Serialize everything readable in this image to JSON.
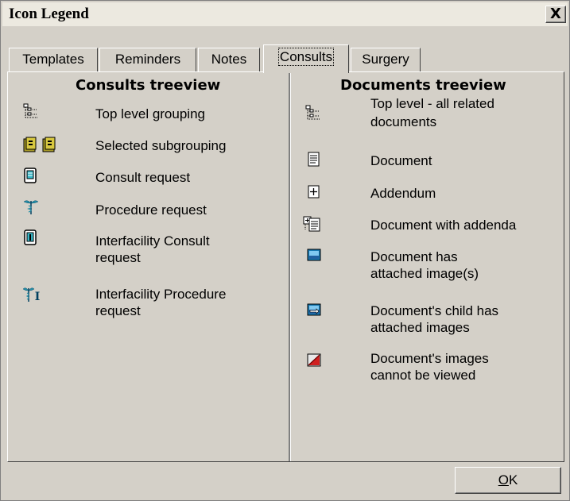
{
  "window": {
    "title": "Icon Legend",
    "close_glyph": "X"
  },
  "tabs": [
    {
      "label": "Templates",
      "active": false
    },
    {
      "label": "Reminders",
      "active": false
    },
    {
      "label": "Notes",
      "active": false
    },
    {
      "label": "Consults",
      "active": true
    },
    {
      "label": "Surgery",
      "active": false
    }
  ],
  "consults_treeview": {
    "title": "Consults treeview",
    "items": [
      {
        "icon": "tree-grouping-icon",
        "label": "Top level grouping"
      },
      {
        "icon": "subgrouping-books-icon",
        "label": "Selected subgrouping"
      },
      {
        "icon": "consult-request-icon",
        "label": "Consult request"
      },
      {
        "icon": "caduceus-icon",
        "label": "Procedure request"
      },
      {
        "icon": "interfacility-consult-icon",
        "label": "Interfacility Consult",
        "label2": "request"
      },
      {
        "icon": "interfacility-procedure-icon",
        "label": "Interfacility Procedure",
        "label2": "request"
      }
    ]
  },
  "documents_treeview": {
    "title": "Documents treeview",
    "items": [
      {
        "icon": "tree-grouping-icon",
        "label": "Top level - all related",
        "label2": "documents"
      },
      {
        "icon": "document-icon",
        "label": "Document"
      },
      {
        "icon": "addendum-icon",
        "label": "Addendum"
      },
      {
        "icon": "document-with-addenda-icon",
        "label": "Document with addenda"
      },
      {
        "icon": "image-attached-icon",
        "label": "Document has",
        "label2": "attached image(s)"
      },
      {
        "icon": "child-image-icon",
        "label": "Document's child has",
        "label2": "attached images"
      },
      {
        "icon": "image-blocked-icon",
        "label": "Document's images",
        "label2": "cannot be viewed"
      }
    ]
  },
  "footer": {
    "ok_label_first": "O",
    "ok_label_rest": "K"
  },
  "colors": {
    "dialog_face": "#d4d0c8",
    "titlebar": "#ece9e0"
  }
}
